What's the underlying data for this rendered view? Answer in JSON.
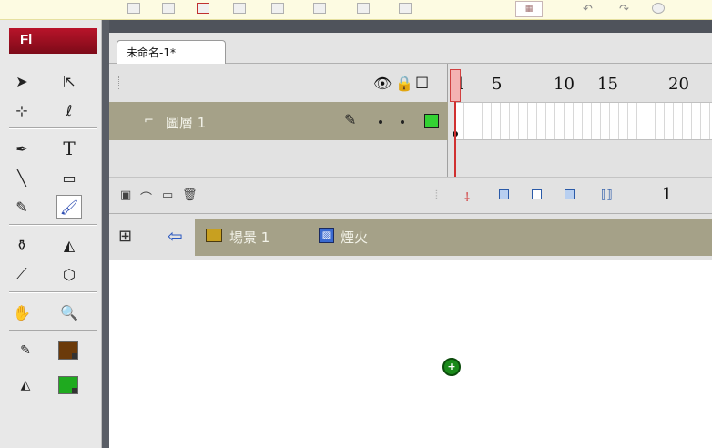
{
  "app": {
    "logo_text": "Fl"
  },
  "document": {
    "tab_title": "未命名-1*"
  },
  "timeline": {
    "frame_numbers": [
      "1",
      "5",
      "10",
      "15",
      "20"
    ],
    "current_frame": "1",
    "layers": [
      {
        "name": "圖層 1",
        "color": "#33d133",
        "selected": true
      }
    ]
  },
  "edit_bar": {
    "scene_label": "場景 1",
    "symbol_label": "煙火"
  },
  "icons": {
    "tools": [
      "selection-arrow",
      "subselection-arrow",
      "free-transform",
      "lasso",
      "pen",
      "text",
      "line",
      "rectangle",
      "pencil",
      "brush",
      "ink-bottle",
      "paint-bucket",
      "eyedropper",
      "eraser",
      "hand",
      "zoom",
      "stroke-color",
      "fill-color"
    ],
    "stroke_color": "#6b3a0a",
    "fill_color": "#1faa1f"
  },
  "colors": {
    "layer_row_bg": "#a5a188",
    "playhead": "#d04040",
    "logo_red": "#9e1020"
  }
}
